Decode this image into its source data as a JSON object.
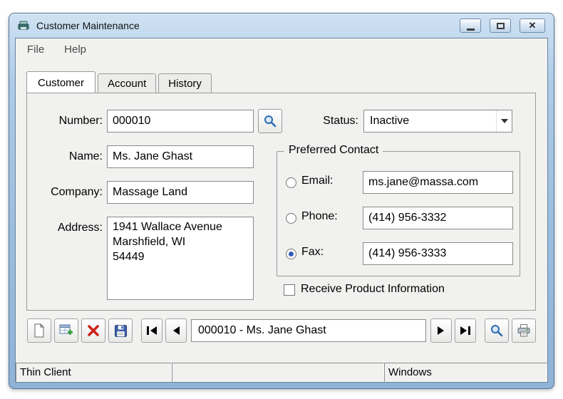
{
  "window": {
    "title": "Customer Maintenance"
  },
  "titlebar_icons": {
    "close_glyph": "✕"
  },
  "menu": {
    "file": "File",
    "help": "Help"
  },
  "tabs": {
    "customer": "Customer",
    "account": "Account",
    "history": "History"
  },
  "form": {
    "number_label": "Number:",
    "number_value": "000010",
    "status_label": "Status:",
    "status_value": "Inactive",
    "name_label": "Name:",
    "name_value": "Ms. Jane Ghast",
    "company_label": "Company:",
    "company_value": "Massage Land",
    "address_label": "Address:",
    "address_value": "1941 Wallace Avenue\nMarshfield, WI\n54449",
    "contact_group": {
      "legend": "Preferred Contact",
      "email_label": "Email:",
      "email_value": "ms.jane@massa.com",
      "phone_label": "Phone:",
      "phone_value": "(414) 956-3332",
      "fax_label": "Fax:",
      "fax_value": "(414) 956-3333",
      "selected": "fax"
    },
    "receive_label": "Receive Product Information",
    "receive_checked": false
  },
  "toolbar": {
    "record_value": "000010 - Ms. Jane Ghast"
  },
  "statusbar": {
    "left": "Thin Client",
    "middle": "",
    "right": "Windows"
  }
}
